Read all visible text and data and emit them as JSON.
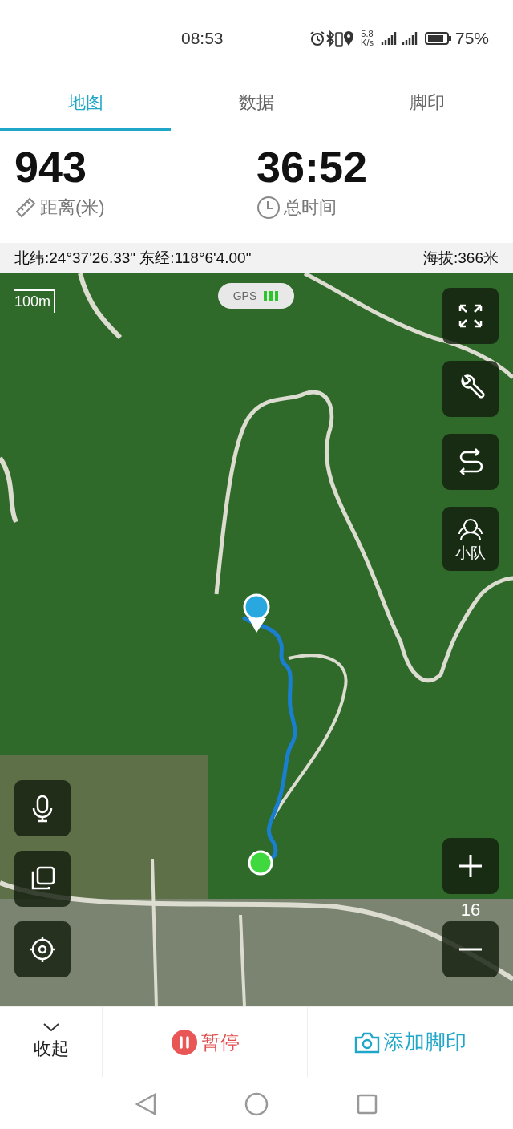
{
  "status_bar": {
    "time": "08:53",
    "speed": "5.8",
    "speed_unit": "K/s",
    "battery": "75%"
  },
  "tabs": [
    {
      "label": "地图",
      "selected": true
    },
    {
      "label": "数据",
      "selected": false
    },
    {
      "label": "脚印",
      "selected": false
    }
  ],
  "stats": [
    {
      "kind": "distance",
      "value": "943",
      "label": "距离(米)"
    },
    {
      "kind": "time",
      "value": "36:52",
      "label": "总时间"
    }
  ],
  "coordinates": {
    "position": "北纬:24°37'26.33\" 东经:118°6'4.00\"",
    "altitude": "海拔:366米"
  },
  "map": {
    "scale": "100m",
    "gps": {
      "label": "GPS"
    },
    "right_controls": [
      {
        "kind": "fullscreen"
      },
      {
        "kind": "tools"
      },
      {
        "kind": "route"
      },
      {
        "kind": "team",
        "label": "小队"
      }
    ],
    "left_controls": [
      {
        "kind": "voice"
      },
      {
        "kind": "layers"
      },
      {
        "kind": "locate"
      }
    ],
    "zoom_level": "16"
  },
  "bottom_actions": [
    {
      "kind": "collapse",
      "label": "收起"
    },
    {
      "kind": "pause",
      "label": "暂停"
    },
    {
      "kind": "footprint",
      "label": "添加脚印"
    }
  ]
}
